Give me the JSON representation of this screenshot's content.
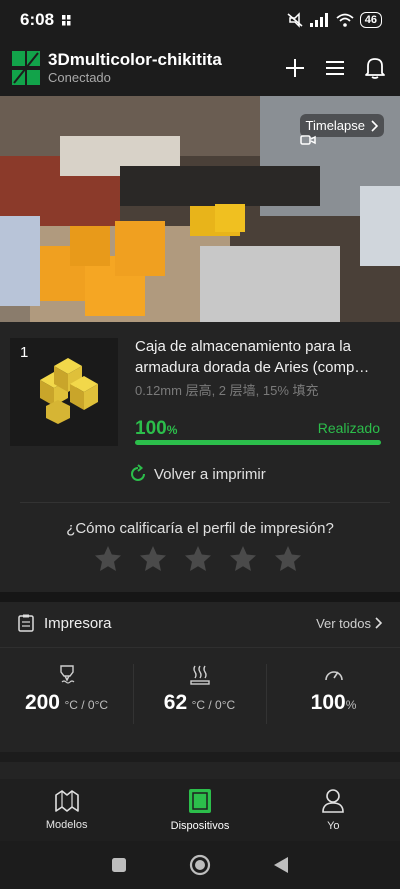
{
  "status": {
    "time": "6:08",
    "battery": "46"
  },
  "header": {
    "title": "3Dmulticolor-chikitita",
    "subtitle": "Conectado",
    "logo_color": "#12a34a"
  },
  "camera": {
    "timelapse_label": "Timelapse"
  },
  "job": {
    "plate_number": "1",
    "title": "Caja de almacenamiento para la armadura dorada de Aries (comp…",
    "meta": "0.12mm 层高, 2 层墙, 15% 填充",
    "progress_value": "100",
    "progress_unit": "%",
    "progress_fraction": 1.0,
    "status": "Realizado",
    "reprint_label": "Volver a imprimir",
    "rating_question": "¿Cómo calificaría el perfil de impresión?",
    "star_count": 5,
    "accent": "#2cbe4b"
  },
  "printer": {
    "section_label": "Impresora",
    "view_all_label": "Ver todos",
    "nozzle": {
      "value": "200",
      "unit": "°C / 0°C"
    },
    "bed": {
      "value": "62",
      "unit": "°C / 0°C"
    },
    "fan": {
      "value": "100",
      "unit": "%"
    }
  },
  "tabs": [
    {
      "label": "Modelos",
      "icon": "models-icon",
      "active": false
    },
    {
      "label": "Dispositivos",
      "icon": "devices-icon",
      "active": true
    },
    {
      "label": "Yo",
      "icon": "profile-icon",
      "active": false
    }
  ]
}
